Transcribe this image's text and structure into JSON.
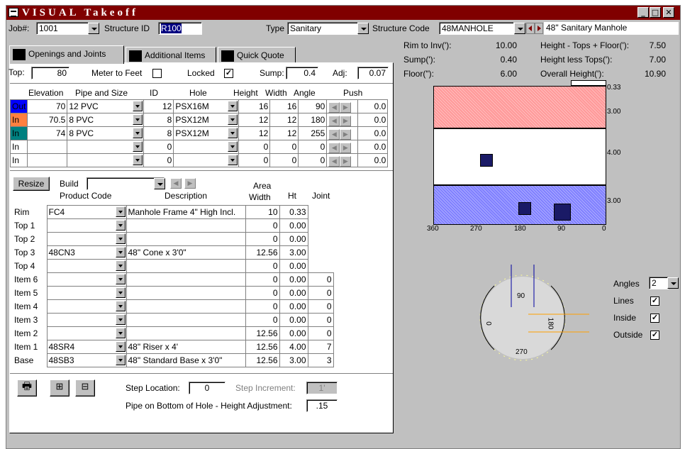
{
  "window": {
    "title": "VISUAL Takeoff",
    "min": "_",
    "max": "□",
    "close": "✕"
  },
  "top": {
    "job_label": "Job#:",
    "job_value": "1001",
    "structure_id_label": "Structure ID",
    "structure_id_value": "R100",
    "type_label": "Type",
    "type_value": "Sanitary",
    "structure_code_label": "Structure Code",
    "structure_code_value": "48MANHOLE",
    "structure_desc": "48\" Sanitary Manhole"
  },
  "tabs": [
    {
      "label": "Openings and Joints"
    },
    {
      "label": "Additional Items"
    },
    {
      "label": "Quick Quote"
    }
  ],
  "settings": {
    "top_label": "Top:",
    "top_value": "80",
    "meter_label": "Meter to Feet",
    "meter_checked": false,
    "locked_label": "Locked",
    "locked_checked": true,
    "sump_label": "Sump:",
    "sump_value": "0.4",
    "adj_label": "Adj:",
    "adj_value": "0.07"
  },
  "openings": {
    "headers": [
      "Elevation",
      "Pipe and Size",
      "ID",
      "Hole",
      "Height",
      "Width",
      "Angle",
      "Push"
    ],
    "rows": [
      {
        "dir": "Out",
        "color": "#0000ff",
        "elev": "70",
        "pipe": "12 PVC",
        "id": "12",
        "hole": "PSX16M",
        "height": "16",
        "width": "16",
        "angle": "90",
        "push": "0.0"
      },
      {
        "dir": "In",
        "color": "#ff8040",
        "elev": "70.5",
        "pipe": "8 PVC",
        "id": "8",
        "hole": "PSX12M",
        "height": "12",
        "width": "12",
        "angle": "180",
        "push": "0.0"
      },
      {
        "dir": "In",
        "color": "#008080",
        "elev": "74",
        "pipe": "8 PVC",
        "id": "8",
        "hole": "PSX12M",
        "height": "12",
        "width": "12",
        "angle": "255",
        "push": "0.0"
      },
      {
        "dir": "In",
        "color": "",
        "elev": "",
        "pipe": "",
        "id": "0",
        "hole": "",
        "height": "0",
        "width": "0",
        "angle": "0",
        "push": "0.0"
      },
      {
        "dir": "In",
        "color": "",
        "elev": "",
        "pipe": "",
        "id": "0",
        "hole": "",
        "height": "0",
        "width": "0",
        "angle": "0",
        "push": "0.0"
      }
    ]
  },
  "build": {
    "resize_label": "Resize",
    "build_label": "Build",
    "build_value": ""
  },
  "products": {
    "headers": {
      "code": "Product Code",
      "desc": "Description",
      "area": "Area",
      "width": "Width",
      "ht": "Ht",
      "joint": "Joint"
    },
    "rows": [
      {
        "name": "Rim",
        "code": "FC4",
        "desc": "Manhole Frame 4\" High Incl.",
        "width": "10",
        "ht": "0.33",
        "joint": ""
      },
      {
        "name": "Top 1",
        "code": "",
        "desc": "",
        "width": "0",
        "ht": "0.00",
        "joint": ""
      },
      {
        "name": "Top 2",
        "code": "",
        "desc": "",
        "width": "0",
        "ht": "0.00",
        "joint": ""
      },
      {
        "name": "Top 3",
        "code": "48CN3",
        "desc": "48\" Cone x 3'0\"",
        "width": "12.56",
        "ht": "3.00",
        "joint": ""
      },
      {
        "name": "Top 4",
        "code": "",
        "desc": "",
        "width": "0",
        "ht": "0.00",
        "joint": ""
      },
      {
        "name": "Item 6",
        "code": "",
        "desc": "",
        "width": "0",
        "ht": "0.00",
        "joint": "0"
      },
      {
        "name": "Item 5",
        "code": "",
        "desc": "",
        "width": "0",
        "ht": "0.00",
        "joint": "0"
      },
      {
        "name": "Item 4",
        "code": "",
        "desc": "",
        "width": "0",
        "ht": "0.00",
        "joint": "0"
      },
      {
        "name": "Item 3",
        "code": "",
        "desc": "",
        "width": "0",
        "ht": "0.00",
        "joint": "0"
      },
      {
        "name": "Item 2",
        "code": "",
        "desc": "",
        "width": "12.56",
        "ht": "0.00",
        "joint": "0"
      },
      {
        "name": "Item 1",
        "code": "48SR4",
        "desc": "48\" Riser x 4'",
        "width": "12.56",
        "ht": "4.00",
        "joint": "7"
      },
      {
        "name": "Base",
        "code": "48SB3",
        "desc": "48\" Standard Base x 3'0\"",
        "width": "12.56",
        "ht": "3.00",
        "joint": "3"
      }
    ]
  },
  "bottom": {
    "step_location_label": "Step Location:",
    "step_location_value": "0",
    "step_increment_label": "Step Increment:",
    "step_increment_value": "1'",
    "pipe_adj_label": "Pipe on Bottom of Hole - Height Adjustment:",
    "pipe_adj_value": ".15"
  },
  "summary": {
    "rim_to_inv_label": "Rim to Inv('):",
    "rim_to_inv_value": "10.00",
    "sump_label": "Sump('):",
    "sump_value": "0.40",
    "floor_label": "Floor(\"):",
    "floor_value": "6.00",
    "htf_label": "Height - Tops + Floor('):",
    "htf_value": "7.50",
    "hlt_label": "Height less Tops('):",
    "hlt_value": "7.00",
    "overall_label": "Overall Height('):",
    "overall_value": "10.90"
  },
  "diagram": {
    "section_labels": [
      "0.33",
      "3.00",
      "4.00",
      "3.00"
    ],
    "x_ticks": [
      "360",
      "270",
      "180",
      "90",
      "0"
    ],
    "colors": {
      "cone": "#ff9999",
      "riser": "#ffffff",
      "base": "#8080ff"
    }
  },
  "plan": {
    "labels": [
      "90",
      "0",
      "180",
      "270"
    ],
    "angles_label": "Angles",
    "angles_value": "2",
    "lines_label": "Lines",
    "lines_checked": true,
    "inside_label": "Inside",
    "inside_checked": true,
    "outside_label": "Outside",
    "outside_checked": true
  }
}
